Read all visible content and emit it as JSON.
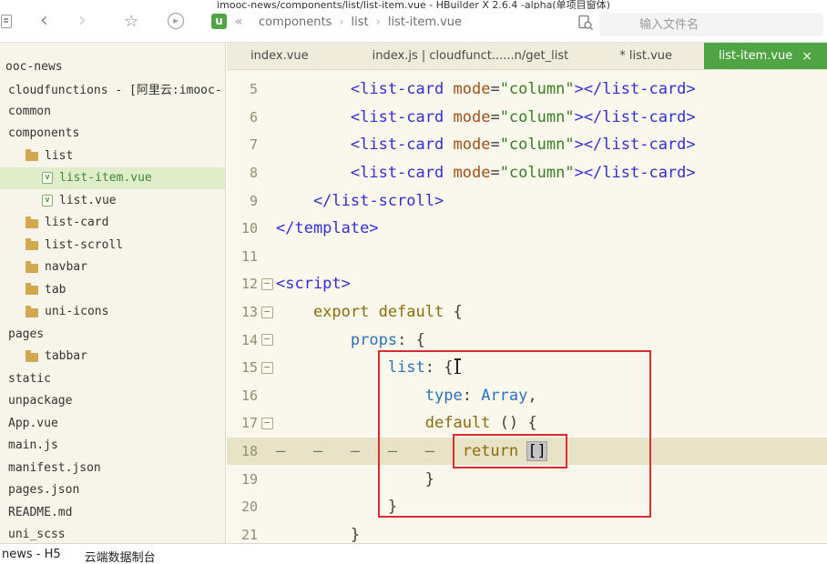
{
  "window": {
    "title": "imooc-news/components/list/list-item.vue - HBuilder X 2.6.4 -alpha(单项目窗体)"
  },
  "colors": {
    "accent_green": "#4FA443",
    "selection_green": "#DFEDCA",
    "annotation_red": "#DD2C2C",
    "editor_bg": "#FAF8ED",
    "sidebar_bg": "#F7F5E9",
    "tabbar_bg": "#EFECDB",
    "current_line": "#E8E3C6",
    "line_number": "#8F8F72",
    "c_tag": "#2F2FD8",
    "c_attr": "#A34F17",
    "c_str": "#377F22",
    "c_kw": "#8F6A08",
    "c_prop": "#2973B7",
    "c_typ": "#2973B7",
    "c_pun": "#3E3E3E"
  },
  "toolbar": {
    "icons": {
      "back": "‹",
      "forward": "›",
      "star": "☆",
      "run": "▸",
      "uni": "u",
      "collapse": "«"
    },
    "breadcrumb": [
      "components",
      "list",
      "list-item.vue"
    ],
    "separator": "›",
    "search_placeholder": "输入文件名"
  },
  "sidebar": {
    "items": [
      {
        "label": "ooc-news",
        "indent": 0,
        "icon": "none",
        "selected": false
      },
      {
        "label": "cloudfunctions - [阿里云:imooc-",
        "indent": 1,
        "icon": "none",
        "selected": false
      },
      {
        "label": "common",
        "indent": 1,
        "icon": "none",
        "selected": false
      },
      {
        "label": "components",
        "indent": 1,
        "icon": "none",
        "selected": false
      },
      {
        "label": "list",
        "indent": 2,
        "icon": "folder",
        "selected": false
      },
      {
        "label": "list-item.vue",
        "indent": 3,
        "icon": "vue",
        "selected": true
      },
      {
        "label": "list.vue",
        "indent": 3,
        "icon": "vue",
        "selected": false
      },
      {
        "label": "list-card",
        "indent": 2,
        "icon": "folder",
        "selected": false
      },
      {
        "label": "list-scroll",
        "indent": 2,
        "icon": "folder",
        "selected": false
      },
      {
        "label": "navbar",
        "indent": 2,
        "icon": "folder",
        "selected": false
      },
      {
        "label": "tab",
        "indent": 2,
        "icon": "folder",
        "selected": false
      },
      {
        "label": "uni-icons",
        "indent": 2,
        "icon": "folder",
        "selected": false
      },
      {
        "label": "pages",
        "indent": 1,
        "icon": "none",
        "selected": false
      },
      {
        "label": "tabbar",
        "indent": 2,
        "icon": "folder",
        "selected": false
      },
      {
        "label": "static",
        "indent": 1,
        "icon": "none",
        "selected": false
      },
      {
        "label": "unpackage",
        "indent": 1,
        "icon": "none",
        "selected": false
      },
      {
        "label": "App.vue",
        "indent": 1,
        "icon": "none",
        "selected": false
      },
      {
        "label": "main.js",
        "indent": 1,
        "icon": "none",
        "selected": false
      },
      {
        "label": "manifest.json",
        "indent": 1,
        "icon": "none",
        "selected": false
      },
      {
        "label": "pages.json",
        "indent": 1,
        "icon": "none",
        "selected": false
      },
      {
        "label": "README.md",
        "indent": 1,
        "icon": "none",
        "selected": false
      },
      {
        "label": "uni_scss",
        "indent": 1,
        "icon": "none",
        "selected": false
      }
    ]
  },
  "tabs": [
    {
      "label": "index.vue",
      "active": false
    },
    {
      "label": "index.js | cloudfunct......n/get_list",
      "active": false
    },
    {
      "label": "* list.vue",
      "active": false
    },
    {
      "label": "list-item.vue",
      "close": "×",
      "active": true
    }
  ],
  "editor": {
    "lines": [
      {
        "num": 5,
        "fold": false,
        "segs": [
          [
            "tag",
            "        <list-card"
          ],
          [
            "pun",
            " "
          ],
          [
            "attr",
            "mode"
          ],
          [
            "pun",
            "="
          ],
          [
            "str",
            "\"column\""
          ],
          [
            "tag",
            "></list-card>"
          ]
        ]
      },
      {
        "num": 6,
        "fold": false,
        "segs": [
          [
            "tag",
            "        <list-card"
          ],
          [
            "pun",
            " "
          ],
          [
            "attr",
            "mode"
          ],
          [
            "pun",
            "="
          ],
          [
            "str",
            "\"column\""
          ],
          [
            "tag",
            "></list-card>"
          ]
        ]
      },
      {
        "num": 7,
        "fold": false,
        "segs": [
          [
            "tag",
            "        <list-card"
          ],
          [
            "pun",
            " "
          ],
          [
            "attr",
            "mode"
          ],
          [
            "pun",
            "="
          ],
          [
            "str",
            "\"column\""
          ],
          [
            "tag",
            "></list-card>"
          ]
        ]
      },
      {
        "num": 8,
        "fold": false,
        "segs": [
          [
            "tag",
            "        <list-card"
          ],
          [
            "pun",
            " "
          ],
          [
            "attr",
            "mode"
          ],
          [
            "pun",
            "="
          ],
          [
            "str",
            "\"column\""
          ],
          [
            "tag",
            "></list-card>"
          ]
        ]
      },
      {
        "num": 9,
        "fold": false,
        "segs": [
          [
            "tag",
            "    </list-scroll>"
          ]
        ]
      },
      {
        "num": 10,
        "fold": false,
        "segs": [
          [
            "tag",
            "</template>"
          ]
        ]
      },
      {
        "num": 11,
        "fold": false,
        "segs": []
      },
      {
        "num": 12,
        "fold": true,
        "segs": [
          [
            "tag",
            "<script>"
          ]
        ]
      },
      {
        "num": 13,
        "fold": true,
        "segs": [
          [
            "kw",
            "    export default"
          ],
          [
            "pun",
            " {"
          ]
        ]
      },
      {
        "num": 14,
        "fold": true,
        "segs": [
          [
            "plain",
            "        "
          ],
          [
            "prop",
            "props"
          ],
          [
            "pun",
            ": {"
          ]
        ]
      },
      {
        "num": 15,
        "fold": true,
        "segs": [
          [
            "plain",
            "            "
          ],
          [
            "prop",
            "list"
          ],
          [
            "pun",
            ": {"
          ]
        ]
      },
      {
        "num": 16,
        "fold": false,
        "segs": [
          [
            "plain",
            "                "
          ],
          [
            "prop",
            "type"
          ],
          [
            "pun",
            ": "
          ],
          [
            "typ",
            "Array"
          ],
          [
            "pun",
            ","
          ]
        ]
      },
      {
        "num": 17,
        "fold": true,
        "segs": [
          [
            "plain",
            "                "
          ],
          [
            "kw",
            "default"
          ],
          [
            "pun",
            " () {"
          ]
        ]
      },
      {
        "num": 18,
        "fold": false,
        "current": true,
        "segs": [
          [
            "ws",
            "—   —   —   —   —   "
          ],
          [
            "kw",
            "return"
          ],
          [
            "plain",
            " "
          ],
          [
            "sel",
            "[]"
          ]
        ]
      },
      {
        "num": 19,
        "fold": false,
        "segs": [
          [
            "plain",
            "                "
          ],
          [
            "pun",
            "}"
          ]
        ]
      },
      {
        "num": 20,
        "fold": false,
        "segs": [
          [
            "plain",
            "            "
          ],
          [
            "pun",
            "}"
          ]
        ]
      },
      {
        "num": 21,
        "fold": false,
        "segs": [
          [
            "plain",
            "        "
          ],
          [
            "pun",
            "}"
          ]
        ]
      }
    ]
  },
  "console": {
    "tabs": [
      "news - H5",
      "云端数据制台"
    ]
  }
}
